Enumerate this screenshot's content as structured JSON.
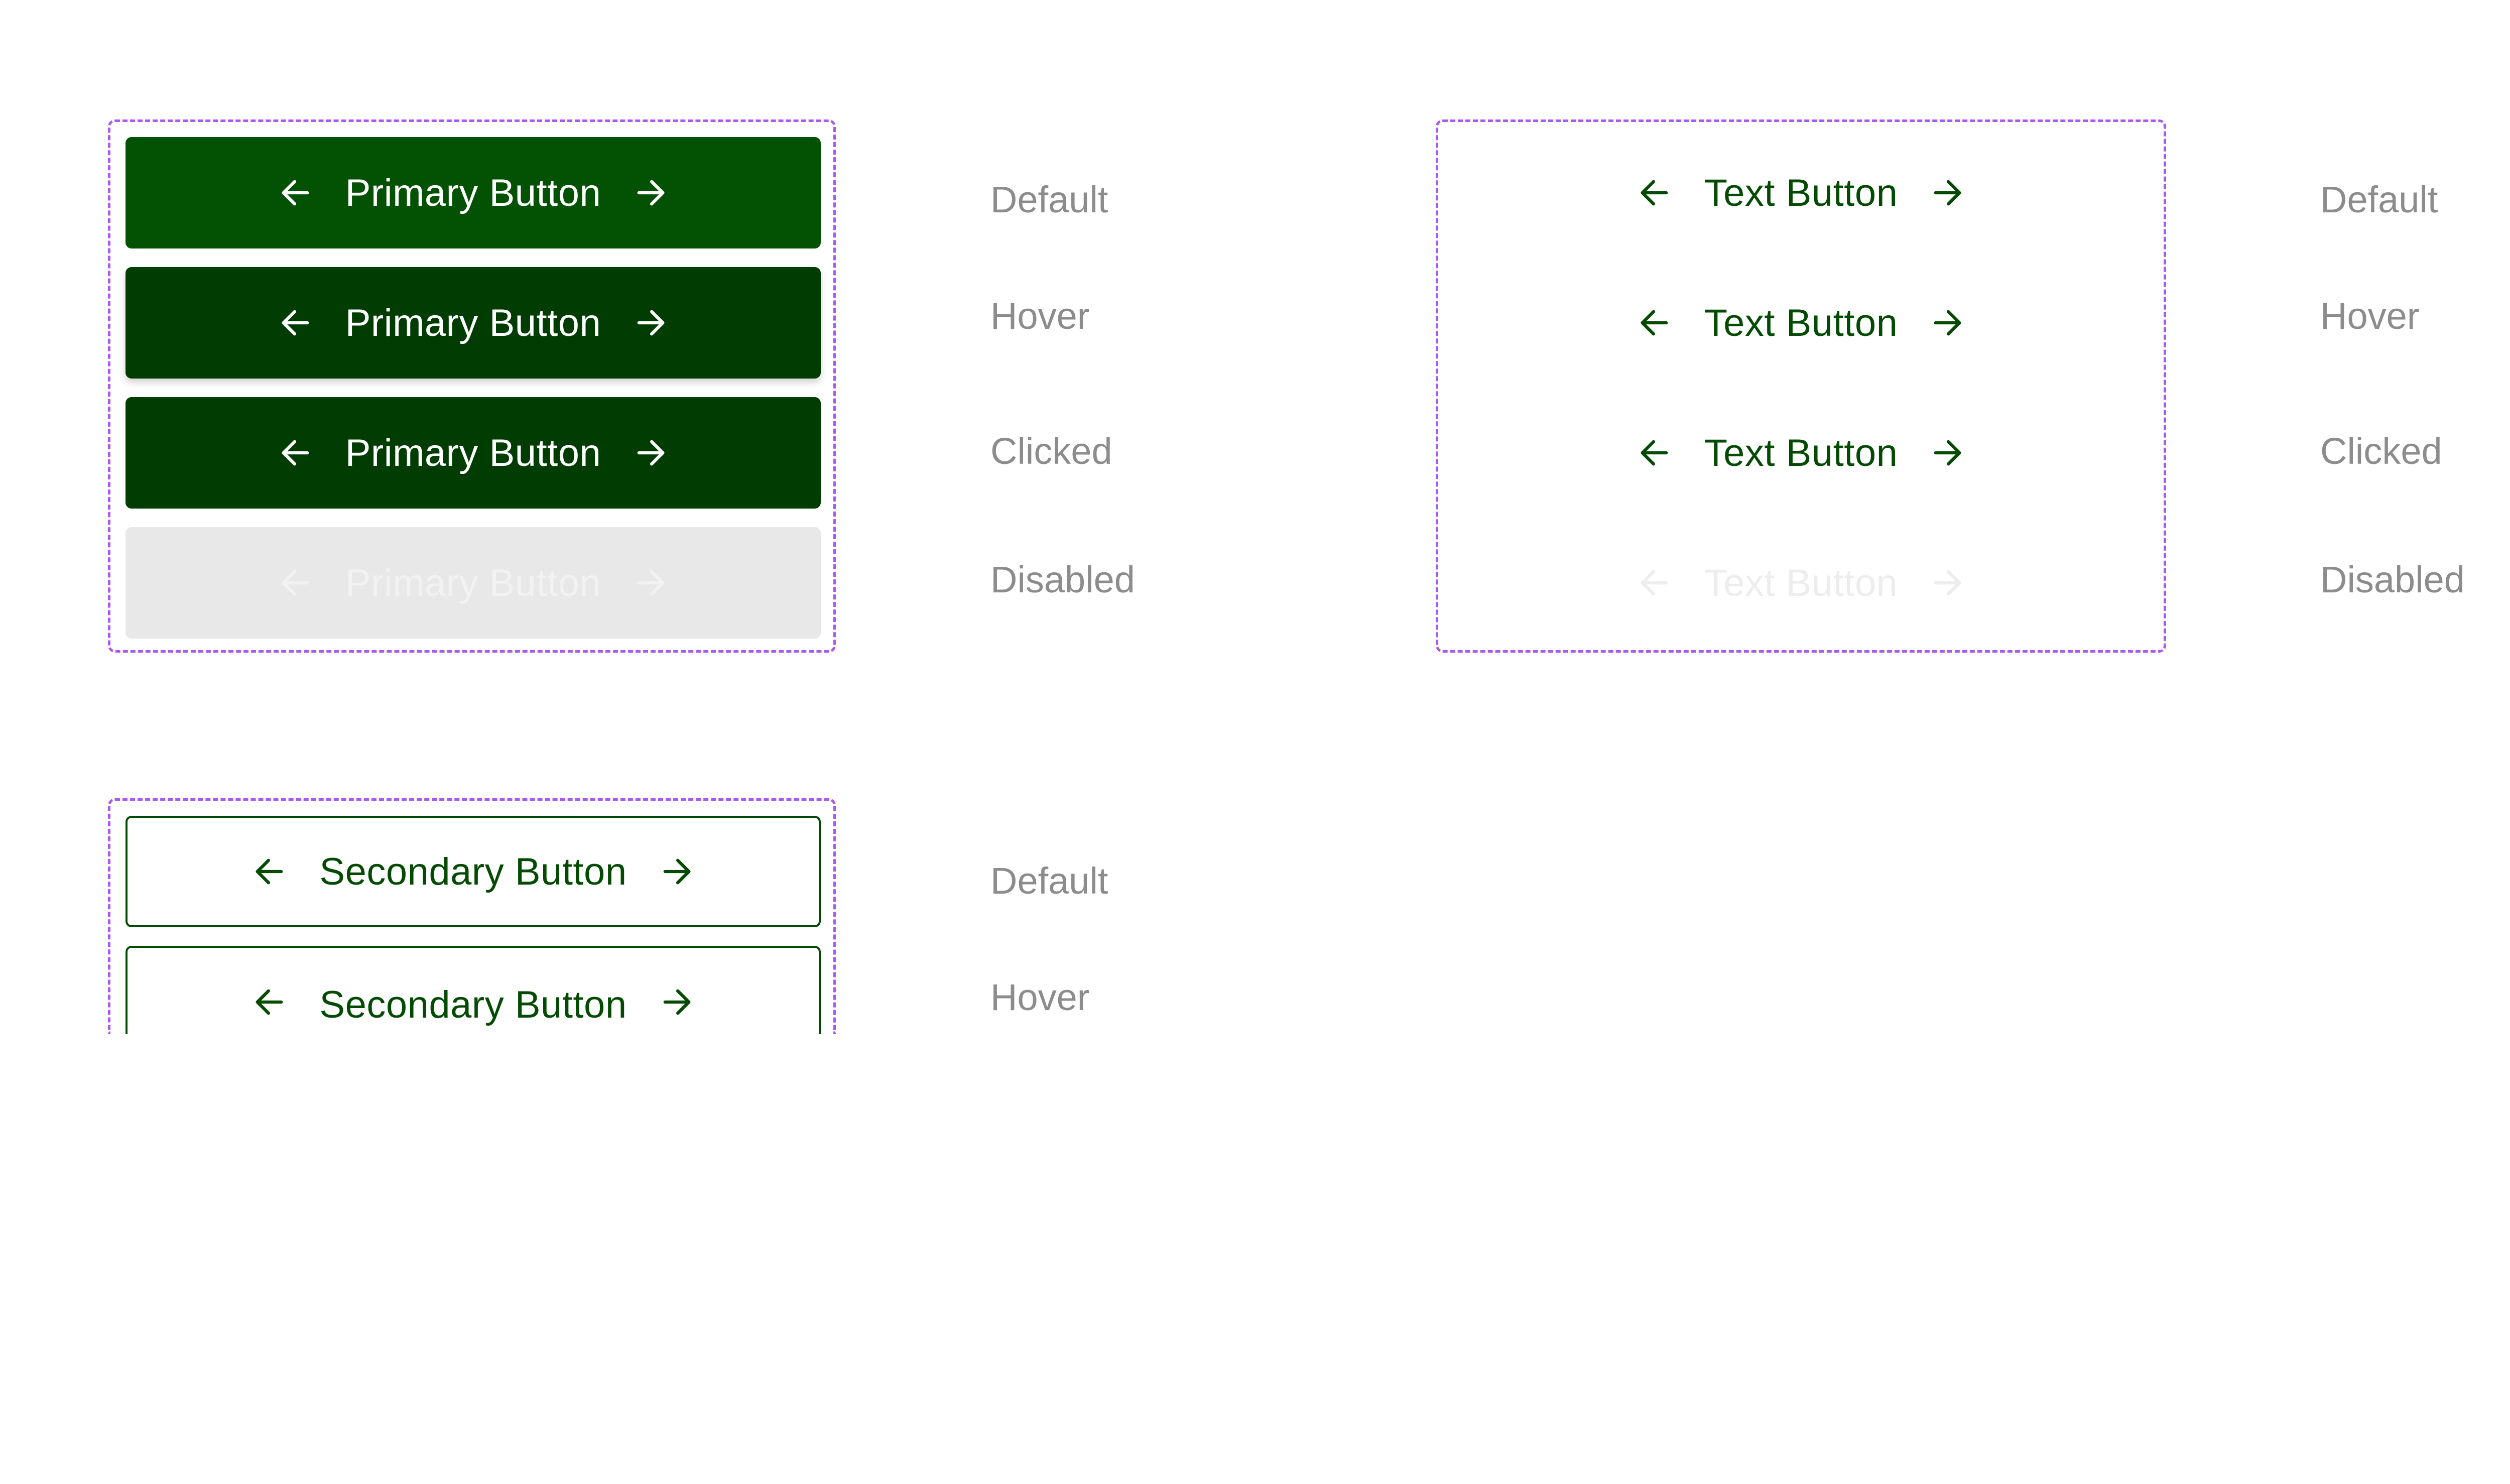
{
  "colors": {
    "primary_default": "#035203",
    "primary_dark": "#013d02",
    "disabled_bg": "#e8e8e8",
    "text_green": "#034a03",
    "group_border": "#a958f0",
    "state_label": "#8c8c8c"
  },
  "icons": {
    "left": "arrow-left-icon",
    "right": "arrow-right-icon"
  },
  "primary": {
    "label": "Primary Button",
    "states": [
      "Default",
      "Hover",
      "Clicked",
      "Disabled"
    ]
  },
  "text_buttons": {
    "label": "Text Button",
    "states": [
      "Default",
      "Hover",
      "Clicked",
      "Disabled"
    ]
  },
  "secondary": {
    "label": "Secondary Button",
    "states": [
      "Default",
      "Hover"
    ]
  }
}
